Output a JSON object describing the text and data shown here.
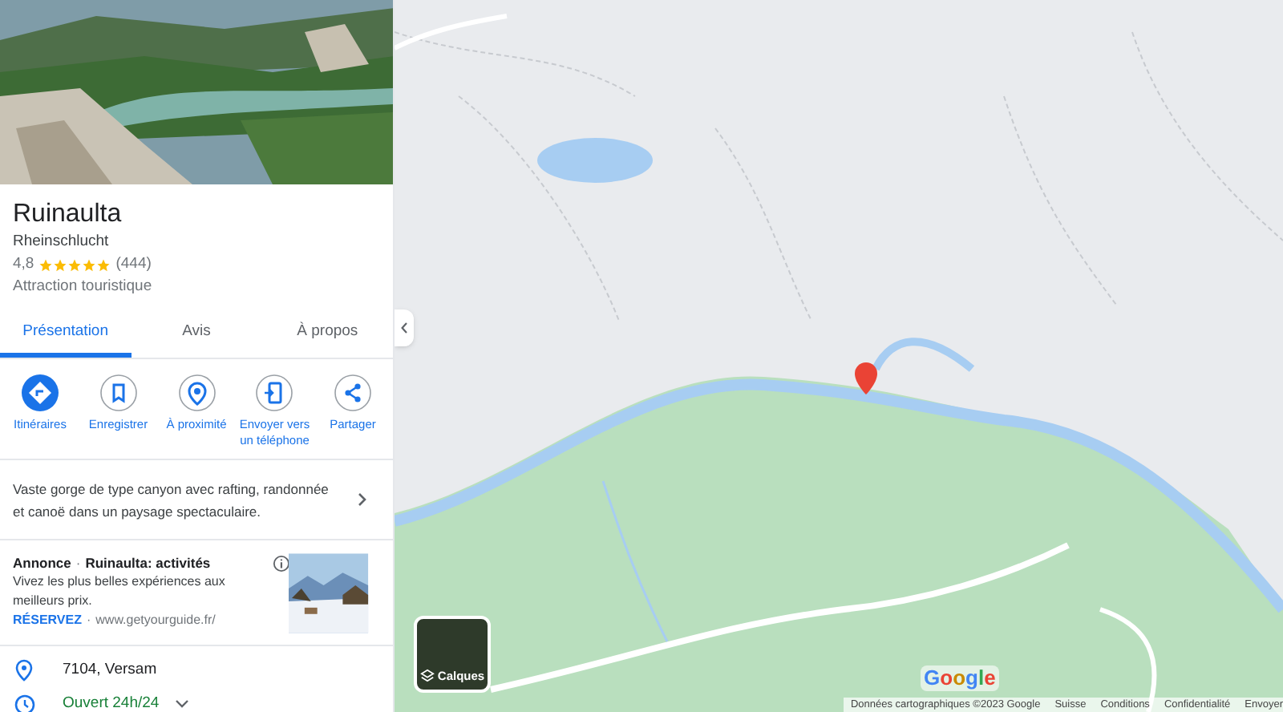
{
  "place": {
    "name": "Ruinaulta",
    "subtitle": "Rheinschlucht",
    "rating": "4,8",
    "stars": 5,
    "reviews": "(444)",
    "category": "Attraction touristique"
  },
  "tabs": [
    {
      "label": "Présentation",
      "selected": true
    },
    {
      "label": "Avis",
      "selected": false
    },
    {
      "label": "À propos",
      "selected": false
    }
  ],
  "actions": [
    {
      "label": "Itinéraires",
      "primary": true
    },
    {
      "label": "Enregistrer",
      "primary": false
    },
    {
      "label": "À proximité",
      "primary": false
    },
    {
      "label": "Envoyer vers un téléphone",
      "primary": false
    },
    {
      "label": "Partager",
      "primary": false
    }
  ],
  "description": "Vaste gorge de type canyon avec rafting, randonnée et canoë dans un paysage spectaculaire.",
  "ad": {
    "label": "Annonce",
    "title_separator": "·",
    "title": "Ruinaulta: activités",
    "cta_separator": "·",
    "text": "Vivez les plus belles expériences aux meilleurs prix.",
    "cta": "RÉSERVEZ",
    "url": "www.getyourguide.fr/"
  },
  "info": [
    {
      "kind": "address",
      "text": "7104, Versam"
    },
    {
      "kind": "hours",
      "text": "Ouvert 24h/24"
    }
  ],
  "map": {
    "kind": "picture",
    "layers_button": "Calques",
    "logo": "Google",
    "footer": [
      "Données cartographiques ©2023 Google",
      "Suisse",
      "Conditions",
      "Confidentialité",
      "Envoyer"
    ]
  }
}
